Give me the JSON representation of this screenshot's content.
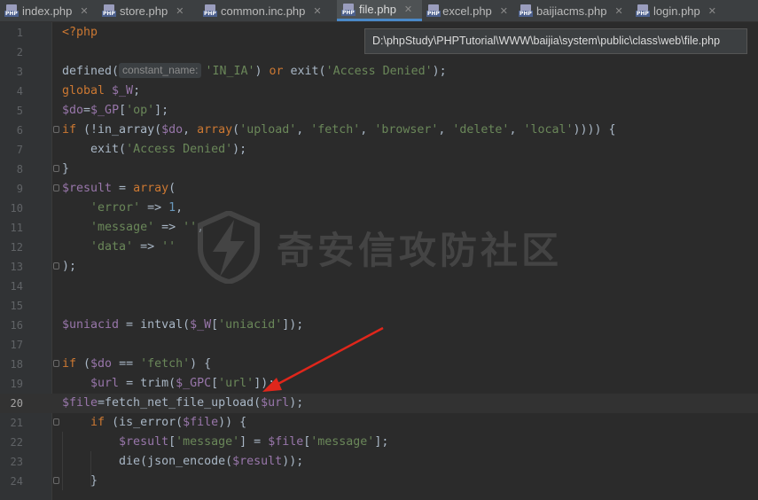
{
  "tabs": [
    {
      "label": "index.php",
      "icon": "php-file-icon",
      "active": false
    },
    {
      "label": "store.php",
      "icon": "php-file-icon",
      "active": false
    },
    {
      "label": "common.inc.php",
      "icon": "php-file-icon",
      "active": false
    },
    {
      "label": "file.php",
      "icon": "php-file-icon",
      "active": true
    },
    {
      "label": "excel.php",
      "icon": "php-file-icon",
      "active": false
    },
    {
      "label": "baijiacms.php",
      "icon": "php-file-icon",
      "active": false
    },
    {
      "label": "login.php",
      "icon": "php-file-icon",
      "active": false
    }
  ],
  "file_icon_text": "PHP",
  "tab_close_glyph": "✕",
  "tooltip": {
    "path": "D:\\phpStudy\\PHPTutorial\\WWW\\baijia\\system\\public\\class\\web\\file.php"
  },
  "inlay_hint": "constant_name:",
  "current_line": 20,
  "watermark": {
    "text": "奇安信攻防社区",
    "logo": "lightning-shield-logo"
  },
  "annotation": {
    "type": "red-arrow",
    "points_to_line": 20,
    "color": "#e0261b"
  },
  "colors": {
    "keyword": "#cc7832",
    "string": "#6a8759",
    "variable": "#9876aa",
    "number": "#6897bb",
    "text": "#a9b7c6",
    "background": "#2b2b2b",
    "gutter": "#313335"
  },
  "lines": [
    {
      "n": "1",
      "tokens": [
        [
          "tag",
          "<?php"
        ]
      ]
    },
    {
      "n": "2",
      "tokens": []
    },
    {
      "n": "3",
      "tokens": [
        [
          "fn",
          "defined("
        ],
        [
          "hint",
          "constant_name:"
        ],
        [
          "str",
          "'IN_IA'"
        ],
        [
          "fn",
          ") "
        ],
        [
          "kw",
          "or "
        ],
        [
          "fn",
          "exit("
        ],
        [
          "str",
          "'Access Denied'"
        ],
        [
          "fn",
          ");"
        ]
      ]
    },
    {
      "n": "4",
      "tokens": [
        [
          "kw",
          "global "
        ],
        [
          "var",
          "$_W"
        ],
        [
          "fn",
          ";"
        ]
      ]
    },
    {
      "n": "5",
      "tokens": [
        [
          "var",
          "$do"
        ],
        [
          "fn",
          "="
        ],
        [
          "var",
          "$_GP"
        ],
        [
          "fn",
          "["
        ],
        [
          "str",
          "'op'"
        ],
        [
          "fn",
          "];"
        ]
      ]
    },
    {
      "n": "6",
      "tokens": [
        [
          "kw",
          "if "
        ],
        [
          "fn",
          "(!in_array("
        ],
        [
          "var",
          "$do"
        ],
        [
          "fn",
          ", "
        ],
        [
          "kw",
          "array"
        ],
        [
          "fn",
          "("
        ],
        [
          "str",
          "'upload'"
        ],
        [
          "fn",
          ", "
        ],
        [
          "str",
          "'fetch'"
        ],
        [
          "fn",
          ", "
        ],
        [
          "str",
          "'browser'"
        ],
        [
          "fn",
          ", "
        ],
        [
          "str",
          "'delete'"
        ],
        [
          "fn",
          ", "
        ],
        [
          "str",
          "'local'"
        ],
        [
          "fn",
          ")))) {"
        ]
      ]
    },
    {
      "n": "7",
      "tokens": [
        [
          "fn",
          "    exit("
        ],
        [
          "str",
          "'Access Denied'"
        ],
        [
          "fn",
          ");"
        ]
      ]
    },
    {
      "n": "8",
      "tokens": [
        [
          "fn",
          "}"
        ]
      ]
    },
    {
      "n": "9",
      "tokens": [
        [
          "var",
          "$result"
        ],
        [
          "fn",
          " = "
        ],
        [
          "kw",
          "array"
        ],
        [
          "fn",
          "("
        ]
      ]
    },
    {
      "n": "10",
      "tokens": [
        [
          "fn",
          "    "
        ],
        [
          "str",
          "'error'"
        ],
        [
          "fn",
          " => "
        ],
        [
          "num",
          "1"
        ],
        [
          "fn",
          ","
        ]
      ]
    },
    {
      "n": "11",
      "tokens": [
        [
          "fn",
          "    "
        ],
        [
          "str",
          "'message'"
        ],
        [
          "fn",
          " => "
        ],
        [
          "str",
          "''"
        ],
        [
          "fn",
          ","
        ]
      ]
    },
    {
      "n": "12",
      "tokens": [
        [
          "fn",
          "    "
        ],
        [
          "str",
          "'data'"
        ],
        [
          "fn",
          " => "
        ],
        [
          "str",
          "''"
        ]
      ]
    },
    {
      "n": "13",
      "tokens": [
        [
          "fn",
          ");"
        ]
      ]
    },
    {
      "n": "14",
      "tokens": []
    },
    {
      "n": "15",
      "tokens": []
    },
    {
      "n": "16",
      "tokens": [
        [
          "var",
          "$uniacid"
        ],
        [
          "fn",
          " = intval("
        ],
        [
          "var",
          "$_W"
        ],
        [
          "fn",
          "["
        ],
        [
          "str",
          "'uniacid'"
        ],
        [
          "fn",
          "]);"
        ]
      ]
    },
    {
      "n": "17",
      "tokens": []
    },
    {
      "n": "18",
      "tokens": [
        [
          "kw",
          "if "
        ],
        [
          "fn",
          "("
        ],
        [
          "var",
          "$do"
        ],
        [
          "fn",
          " == "
        ],
        [
          "str",
          "'fetch'"
        ],
        [
          "fn",
          ") {"
        ]
      ]
    },
    {
      "n": "19",
      "tokens": [
        [
          "fn",
          "    "
        ],
        [
          "var",
          "$url"
        ],
        [
          "fn",
          " = trim("
        ],
        [
          "var",
          "$_GPC"
        ],
        [
          "fn",
          "["
        ],
        [
          "str",
          "'url'"
        ],
        [
          "fn",
          "]);"
        ]
      ]
    },
    {
      "n": "20",
      "tokens": [
        [
          "var",
          "$file"
        ],
        [
          "fn",
          "=fetch_net_file_upload("
        ],
        [
          "var",
          "$url"
        ],
        [
          "fn",
          ");"
        ]
      ]
    },
    {
      "n": "21",
      "tokens": [
        [
          "fn",
          "    "
        ],
        [
          "kw",
          "if "
        ],
        [
          "fn",
          "(is_error("
        ],
        [
          "var",
          "$file"
        ],
        [
          "fn",
          ")) {"
        ]
      ]
    },
    {
      "n": "22",
      "tokens": [
        [
          "fn",
          "        "
        ],
        [
          "var",
          "$result"
        ],
        [
          "fn",
          "["
        ],
        [
          "str",
          "'message'"
        ],
        [
          "fn",
          "] = "
        ],
        [
          "var",
          "$file"
        ],
        [
          "fn",
          "["
        ],
        [
          "str",
          "'message'"
        ],
        [
          "fn",
          "];"
        ]
      ]
    },
    {
      "n": "23",
      "tokens": [
        [
          "fn",
          "        die(json_encode("
        ],
        [
          "var",
          "$result"
        ],
        [
          "fn",
          "));"
        ]
      ]
    },
    {
      "n": "24",
      "tokens": [
        [
          "fn",
          "    }"
        ]
      ]
    }
  ]
}
